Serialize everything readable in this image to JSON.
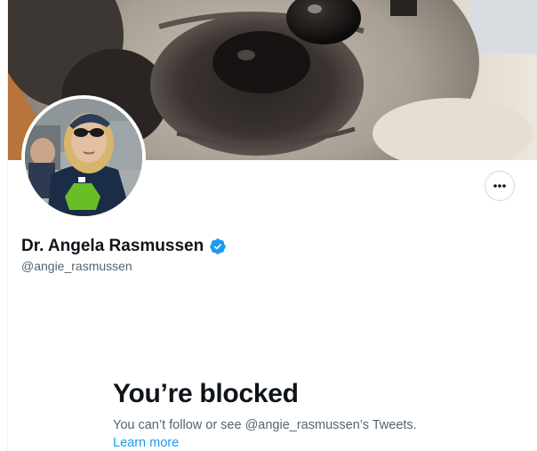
{
  "profile": {
    "display_name": "Dr. Angela Rasmussen",
    "handle": "@angie_rasmussen",
    "verified": true
  },
  "icons": {
    "more": "more-horizontal-icon",
    "verified": "verified-badge-icon"
  },
  "blocked": {
    "title": "You’re blocked",
    "description": "You can’t follow or see @angie_rasmussen’s Tweets.",
    "learn_more": "Learn more"
  },
  "colors": {
    "verified_blue": "#1d9bf0",
    "link_blue": "#1d9bf0",
    "secondary_text": "#536471",
    "primary_text": "#0f1419",
    "border": "#cfd9de"
  }
}
